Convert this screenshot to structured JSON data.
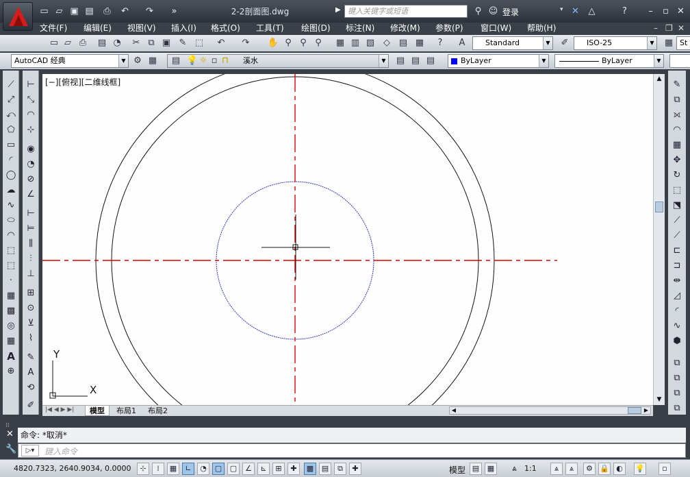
{
  "app": {
    "document_title": "2-2剖面图.dwg",
    "search_placeholder": "键入关键字或短语",
    "login_label": "登录"
  },
  "menu": [
    "文件(F)",
    "编辑(E)",
    "视图(V)",
    "插入(I)",
    "格式(O)",
    "工具(T)",
    "绘图(D)",
    "标注(N)",
    "修改(M)",
    "参数(P)",
    "窗口(W)",
    "帮助(H)"
  ],
  "toolbar1": {
    "text_style": "Standard",
    "dim_style": "ISO-25",
    "table_style_partial": "St"
  },
  "toolbar2": {
    "workspace": "AutoCAD 经典",
    "layer": "溪水",
    "color": "ByLayer",
    "linetype": "ByLayer",
    "color_swatch": "#0000ff"
  },
  "canvas": {
    "viewport_label": "[−][俯视][二维线框]",
    "ucs_y": "Y",
    "ucs_x": "X",
    "centerline_color": "#e00000",
    "small_circle_color": "#3030c0",
    "outline_color": "#111111"
  },
  "layout_tabs": [
    "模型",
    "布局1",
    "布局2"
  ],
  "command": {
    "history": "命令: *取消*",
    "placeholder": "键入命令"
  },
  "status": {
    "coordinates": "4820.7323, 2640.9034, 0.0000",
    "space": "模型",
    "annotation_scale": "1:1"
  }
}
